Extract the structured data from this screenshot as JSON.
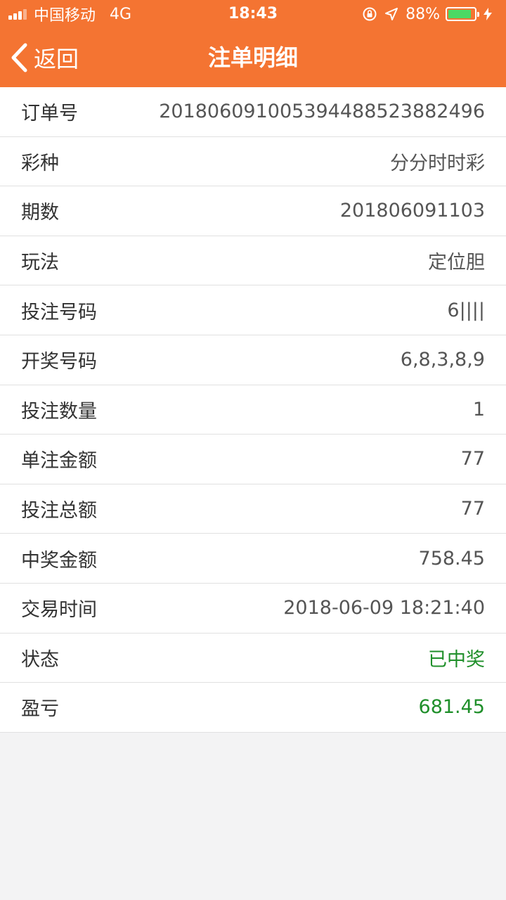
{
  "status_bar": {
    "carrier": "中国移动",
    "network": "4G",
    "time": "18:43",
    "battery_percent": "88%",
    "battery_level": 0.88
  },
  "nav": {
    "back_label": "返回",
    "title": "注单明细"
  },
  "colors": {
    "accent": "#f47432",
    "win_green": "#1f8f2a"
  },
  "details": [
    {
      "label": "订单号",
      "value": "201806091005394488523882496",
      "highlight": false
    },
    {
      "label": "彩种",
      "value": "分分时时彩",
      "highlight": false
    },
    {
      "label": "期数",
      "value": "201806091103",
      "highlight": false
    },
    {
      "label": "玩法",
      "value": "定位胆",
      "highlight": false
    },
    {
      "label": "投注号码",
      "value": "6||||",
      "highlight": false
    },
    {
      "label": "开奖号码",
      "value": "6,8,3,8,9",
      "highlight": false
    },
    {
      "label": "投注数量",
      "value": "1",
      "highlight": false
    },
    {
      "label": "单注金额",
      "value": "77",
      "highlight": false
    },
    {
      "label": "投注总额",
      "value": "77",
      "highlight": false
    },
    {
      "label": "中奖金额",
      "value": "758.45",
      "highlight": false
    },
    {
      "label": "交易时间",
      "value": "2018-06-09 18:21:40",
      "highlight": false
    },
    {
      "label": "状态",
      "value": "已中奖",
      "highlight": true
    },
    {
      "label": "盈亏",
      "value": "681.45",
      "highlight": true
    }
  ]
}
